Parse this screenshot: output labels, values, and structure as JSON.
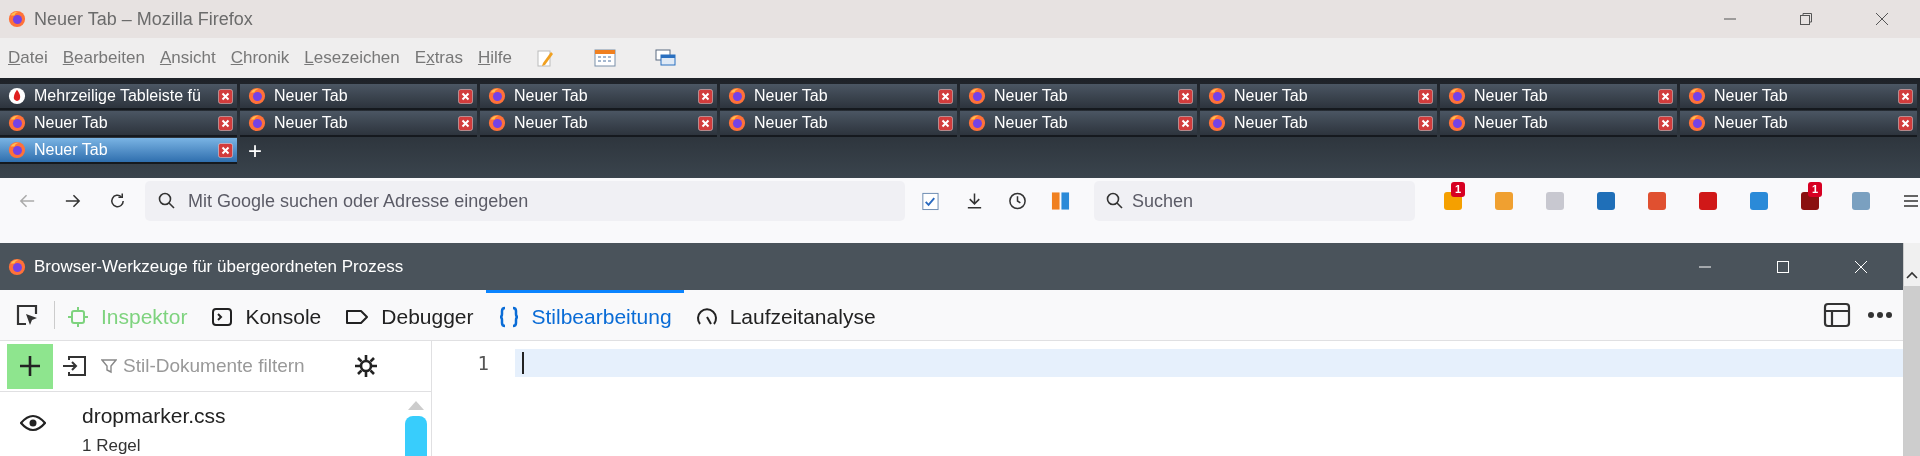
{
  "window": {
    "title": "Neuer Tab – Mozilla Firefox"
  },
  "menu": [
    {
      "key": "D",
      "post": "atei"
    },
    {
      "key": "B",
      "post": "earbeiten"
    },
    {
      "key": "A",
      "post": "nsicht"
    },
    {
      "key": "C",
      "post": "hronik"
    },
    {
      "key": "L",
      "post": "esezeichen"
    },
    {
      "pre": "E",
      "key": "x",
      "post": "tras"
    },
    {
      "key": "H",
      "post": "ilfe"
    }
  ],
  "tab_rows": [
    [
      {
        "label": "Mehrzeilige Tableiste fü",
        "kind": "addon",
        "selected": false
      },
      {
        "label": "Neuer Tab",
        "kind": "firefox",
        "selected": false
      },
      {
        "label": "Neuer Tab",
        "kind": "firefox",
        "selected": false
      },
      {
        "label": "Neuer Tab",
        "kind": "firefox",
        "selected": false
      },
      {
        "label": "Neuer Tab",
        "kind": "firefox",
        "selected": false
      },
      {
        "label": "Neuer Tab",
        "kind": "firefox",
        "selected": false
      },
      {
        "label": "Neuer Tab",
        "kind": "firefox",
        "selected": false
      },
      {
        "label": "Neuer Tab",
        "kind": "firefox",
        "selected": false
      }
    ],
    [
      {
        "label": "Neuer Tab",
        "kind": "firefox",
        "selected": false
      },
      {
        "label": "Neuer Tab",
        "kind": "firefox",
        "selected": false
      },
      {
        "label": "Neuer Tab",
        "kind": "firefox",
        "selected": false
      },
      {
        "label": "Neuer Tab",
        "kind": "firefox",
        "selected": false
      },
      {
        "label": "Neuer Tab",
        "kind": "firefox",
        "selected": false
      },
      {
        "label": "Neuer Tab",
        "kind": "firefox",
        "selected": false
      },
      {
        "label": "Neuer Tab",
        "kind": "firefox",
        "selected": false
      },
      {
        "label": "Neuer Tab",
        "kind": "firefox",
        "selected": false
      }
    ],
    [
      {
        "label": "Neuer Tab",
        "kind": "firefox",
        "selected": true
      }
    ]
  ],
  "new_tab_button": "+",
  "address_bar": {
    "placeholder": "Mit Google suchen oder Adresse eingeben"
  },
  "search_bar": {
    "placeholder": "Suchen"
  },
  "extensions": [
    {
      "color": "#f5a000",
      "badge": "1"
    },
    {
      "color": "#f0a030"
    },
    {
      "color": "#c8c8d0"
    },
    {
      "color": "#1f6fb8"
    },
    {
      "color": "#e05030"
    },
    {
      "color": "#d01818"
    },
    {
      "color": "#2a8ad8"
    },
    {
      "color": "#8a1010",
      "badge": "1"
    },
    {
      "color": "#7aa0c0"
    }
  ],
  "devtools": {
    "title": "Browser-Werkzeuge für übergeordneten Prozess",
    "tabs": [
      {
        "label": "Inspektor",
        "kind": "inspector",
        "selected": false,
        "highlighted": true
      },
      {
        "label": "Konsole",
        "kind": "console",
        "selected": false,
        "highlighted": false
      },
      {
        "label": "Debugger",
        "kind": "debugger",
        "selected": false,
        "highlighted": false
      },
      {
        "label": "Stilbearbeitung",
        "kind": "style",
        "selected": true,
        "highlighted": false
      },
      {
        "label": "Laufzeitanalyse",
        "kind": "performance",
        "selected": false,
        "highlighted": false
      }
    ],
    "filter": {
      "placeholder": "Stil-Dokumente filtern"
    },
    "stylesheets": [
      {
        "name": "dropmarker.css",
        "rules": "1 Regel",
        "visible": true
      }
    ],
    "editor": {
      "line_numbers": [
        "1"
      ]
    }
  }
}
